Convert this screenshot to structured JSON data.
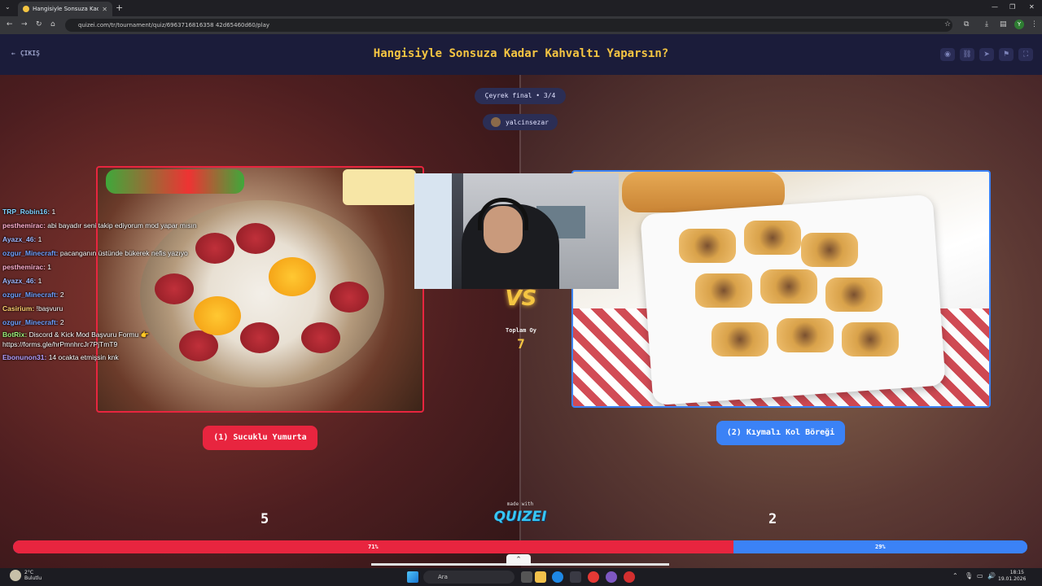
{
  "browser": {
    "tab_title": "Hangisiyle Sonsuza Kadar Kahv",
    "url": "quizei.com/tr/tournament/quiz/6963716816358 42d65460d60/play"
  },
  "header": {
    "exit_label": "ÇIKIŞ",
    "title": "Hangisiyle Sonsuza Kadar Kahvaltı Yaparsın?"
  },
  "round": {
    "label": "Çeyrek final • 3/4",
    "creator": "yalcinsezar"
  },
  "chat": [
    {
      "user": "TRP_Robin16:",
      "msg": "1",
      "color": "#7fd0ff"
    },
    {
      "user": "pesthemirac:",
      "msg": "abi bayadır seni takip ediyorum mod yapar mısın",
      "color": "#ffb0d0"
    },
    {
      "user": "Ayazx_46:",
      "msg": "1",
      "color": "#9fb8ff"
    },
    {
      "user": "ozgur_Minecraft:",
      "msg": "pacanganın üstünde bükerek nefis yazıyo",
      "color": "#6fa0ff"
    },
    {
      "user": "pesthemirac:",
      "msg": "1",
      "color": "#ffb0d0"
    },
    {
      "user": "Ayazx_46:",
      "msg": "1",
      "color": "#9fb8ff"
    },
    {
      "user": "ozgur_Minecraft:",
      "msg": "2",
      "color": "#6fa0ff"
    },
    {
      "user": "Casirium:",
      "msg": "!başvuru",
      "color": "#ffd070"
    },
    {
      "user": "ozgur_Minecraft:",
      "msg": "2",
      "color": "#6fa0ff"
    },
    {
      "user": "BotRix:",
      "msg": "Discord & Kick Mod Başvuru Formu 👉 https://forms.gle/hrPmnhrcJr7PjTmT9",
      "color": "#9cf07a"
    },
    {
      "user": "Ebonunon31:",
      "msg": "14 ocakta etmişsin knk",
      "color": "#b6a0ff"
    }
  ],
  "left": {
    "label": "(1) Sucuklu Yumurta",
    "votes": "5",
    "percent_label": "71%",
    "share": 0.71
  },
  "right": {
    "label": "(2) Kıymalı Kol Böreği",
    "votes": "2",
    "percent_label": "29%"
  },
  "total": {
    "label": "Toplam Oy",
    "value": "7"
  },
  "vs_label": "VS",
  "footer": {
    "made_with": "made with",
    "logo": "QUIZEI"
  },
  "taskbar": {
    "weather_temp": "2°C",
    "weather_desc": "Bulutlu",
    "search_placeholder": "Ara",
    "time": "18:15",
    "date": "19.01.2026"
  },
  "colors": {
    "accent_left": "#e8253f",
    "accent_right": "#3b82f6",
    "title_yellow": "#f5c542"
  }
}
